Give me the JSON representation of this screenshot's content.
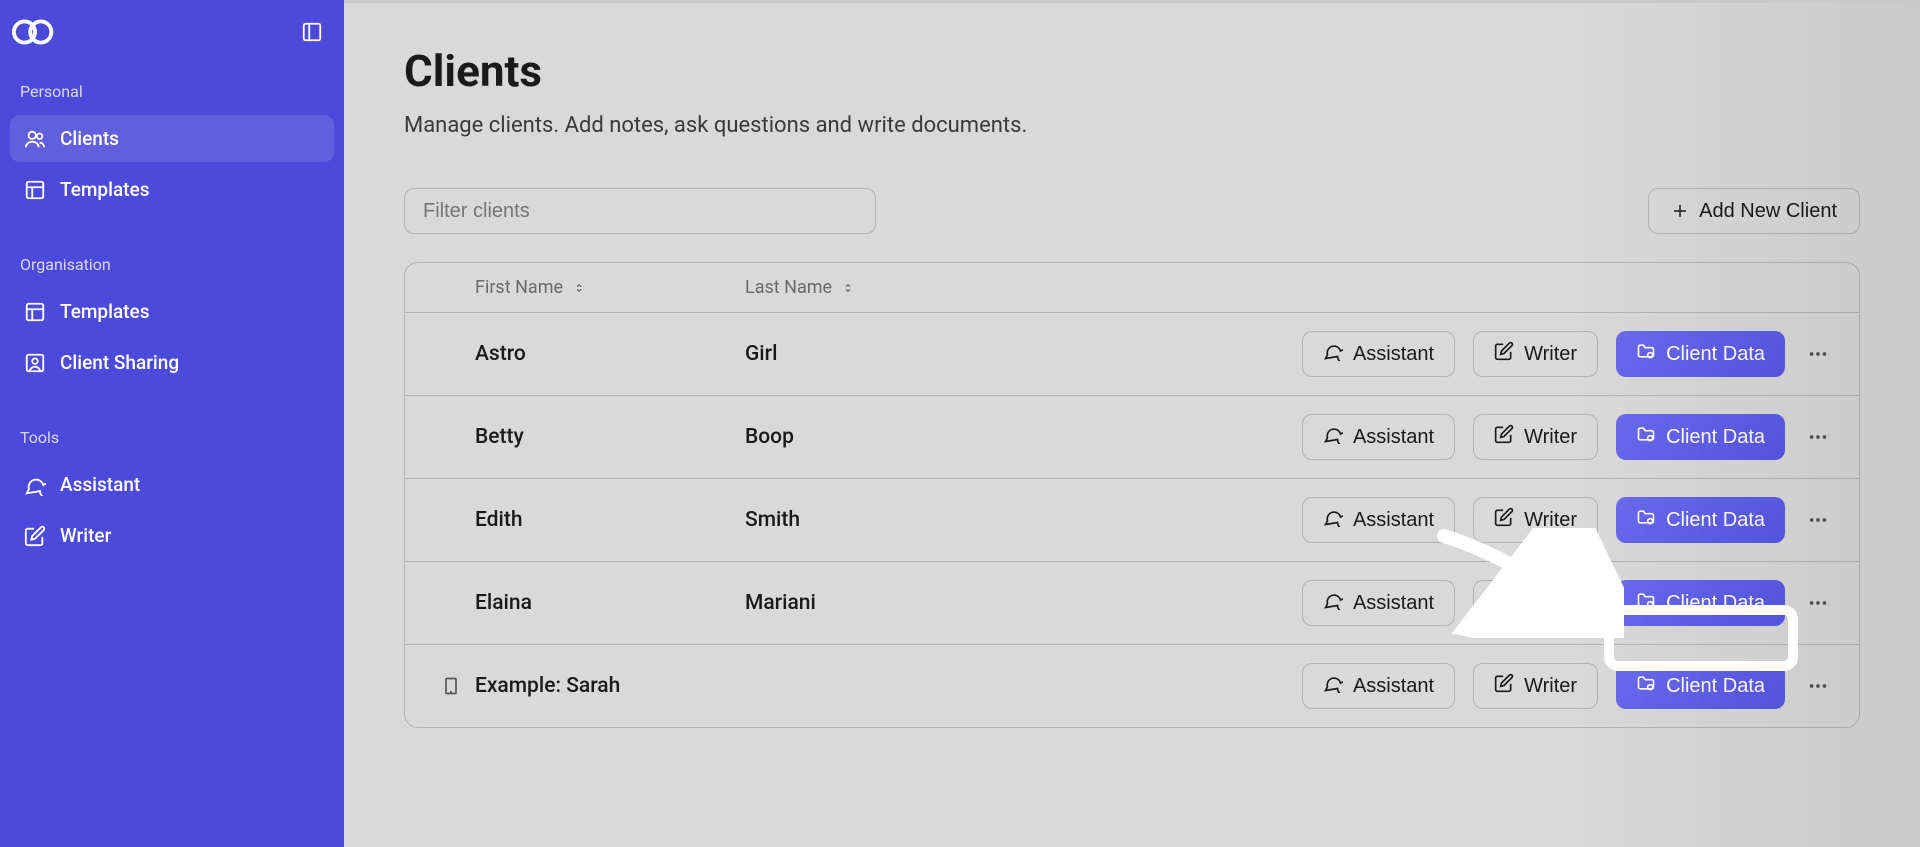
{
  "sidebar": {
    "sections": [
      {
        "label": "Personal",
        "items": [
          {
            "icon": "users",
            "label": "Clients",
            "active": true
          },
          {
            "icon": "template",
            "label": "Templates",
            "active": false
          }
        ]
      },
      {
        "label": "Organisation",
        "items": [
          {
            "icon": "template",
            "label": "Templates",
            "active": false
          },
          {
            "icon": "user-square",
            "label": "Client Sharing",
            "active": false
          }
        ]
      },
      {
        "label": "Tools",
        "items": [
          {
            "icon": "chat",
            "label": "Assistant",
            "active": false
          },
          {
            "icon": "pen",
            "label": "Writer",
            "active": false
          }
        ]
      }
    ]
  },
  "page": {
    "title": "Clients",
    "subtitle": "Manage clients. Add notes, ask questions and write documents.",
    "filter_placeholder": "Filter clients",
    "add_button": "Add New Client",
    "col_first": "First Name",
    "col_last": "Last Name",
    "action_assistant": "Assistant",
    "action_writer": "Writer",
    "action_client_data": "Client Data"
  },
  "clients": [
    {
      "first": "Astro",
      "last": "Girl",
      "hasIcon": false
    },
    {
      "first": "Betty",
      "last": "Boop",
      "hasIcon": false
    },
    {
      "first": "Edith",
      "last": "Smith",
      "hasIcon": false
    },
    {
      "first": "Elaina",
      "last": "Mariani",
      "hasIcon": false
    },
    {
      "first": "Example: Sarah",
      "last": "",
      "hasIcon": true
    }
  ]
}
